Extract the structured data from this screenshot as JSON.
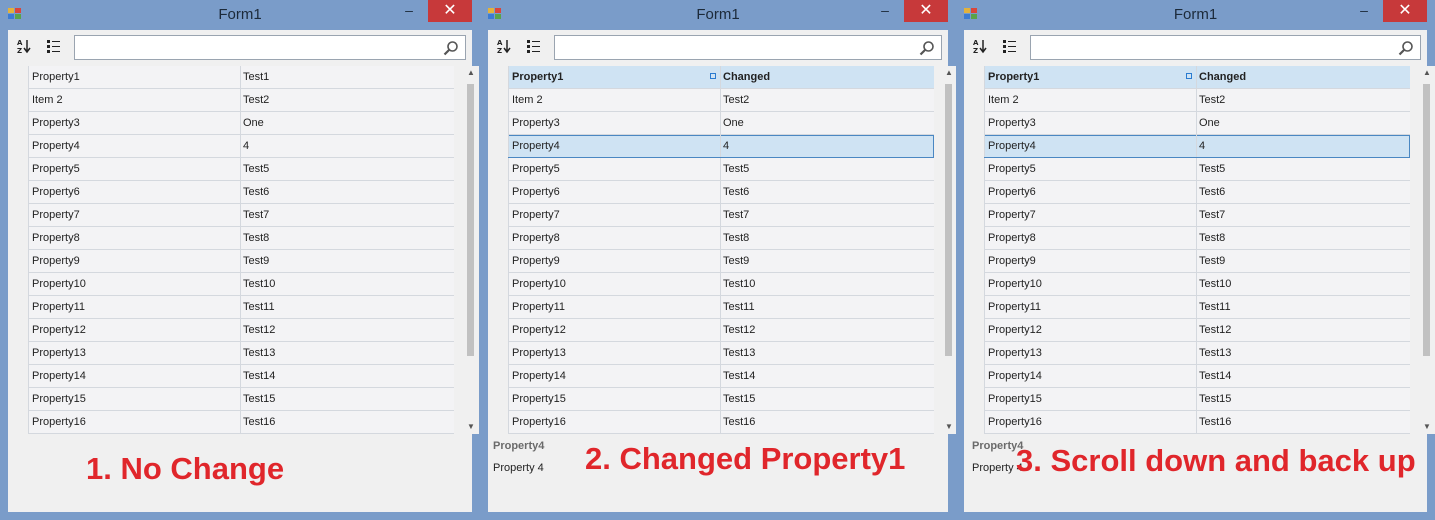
{
  "windows": [
    {
      "title": "Form1",
      "close_glyph": "✕",
      "min_glyph": "–",
      "search_placeholder": "",
      "caption": "1. No Change",
      "help_title": "",
      "help_desc": "",
      "rows": [
        {
          "name": "Property1",
          "value": "Test1"
        },
        {
          "name": "Item 2",
          "value": "Test2"
        },
        {
          "name": "Property3",
          "value": "One"
        },
        {
          "name": "Property4",
          "value": "4"
        },
        {
          "name": "Property5",
          "value": "Test5"
        },
        {
          "name": "Property6",
          "value": "Test6"
        },
        {
          "name": "Property7",
          "value": "Test7"
        },
        {
          "name": "Property8",
          "value": "Test8"
        },
        {
          "name": "Property9",
          "value": "Test9"
        },
        {
          "name": "Property10",
          "value": "Test10"
        },
        {
          "name": "Property11",
          "value": "Test11"
        },
        {
          "name": "Property12",
          "value": "Test12"
        },
        {
          "name": "Property13",
          "value": "Test13"
        },
        {
          "name": "Property14",
          "value": "Test14"
        },
        {
          "name": "Property15",
          "value": "Test15"
        },
        {
          "name": "Property16",
          "value": "Test16"
        }
      ]
    },
    {
      "title": "Form1",
      "close_glyph": "✕",
      "min_glyph": "–",
      "search_placeholder": "",
      "caption": "2. Changed Property1",
      "help_title": "Property4",
      "help_desc": "Property 4",
      "rows": [
        {
          "name": "Property1",
          "value": "Changed",
          "header": true
        },
        {
          "name": "Item 2",
          "value": "Test2"
        },
        {
          "name": "Property3",
          "value": "One"
        },
        {
          "name": "Property4",
          "value": "4",
          "selected": true
        },
        {
          "name": "Property5",
          "value": "Test5"
        },
        {
          "name": "Property6",
          "value": "Test6"
        },
        {
          "name": "Property7",
          "value": "Test7"
        },
        {
          "name": "Property8",
          "value": "Test8"
        },
        {
          "name": "Property9",
          "value": "Test9"
        },
        {
          "name": "Property10",
          "value": "Test10"
        },
        {
          "name": "Property11",
          "value": "Test11"
        },
        {
          "name": "Property12",
          "value": "Test12"
        },
        {
          "name": "Property13",
          "value": "Test13"
        },
        {
          "name": "Property14",
          "value": "Test14"
        },
        {
          "name": "Property15",
          "value": "Test15"
        },
        {
          "name": "Property16",
          "value": "Test16"
        }
      ]
    },
    {
      "title": "Form1",
      "close_glyph": "✕",
      "min_glyph": "–",
      "search_placeholder": "",
      "caption": "3. Scroll down and back up",
      "help_title": "Property4",
      "help_desc": "Property 4",
      "rows": [
        {
          "name": "Property1",
          "value": "Changed",
          "header": true
        },
        {
          "name": "Item 2",
          "value": "Test2"
        },
        {
          "name": "Property3",
          "value": "One"
        },
        {
          "name": "Property4",
          "value": "4",
          "selected": true
        },
        {
          "name": "Property5",
          "value": "Test5"
        },
        {
          "name": "Property6",
          "value": "Test6"
        },
        {
          "name": "Property7",
          "value": "Test7"
        },
        {
          "name": "Property8",
          "value": "Test8"
        },
        {
          "name": "Property9",
          "value": "Test9"
        },
        {
          "name": "Property10",
          "value": "Test10"
        },
        {
          "name": "Property11",
          "value": "Test11"
        },
        {
          "name": "Property12",
          "value": "Test12"
        },
        {
          "name": "Property13",
          "value": "Test13"
        },
        {
          "name": "Property14",
          "value": "Test14"
        },
        {
          "name": "Property15",
          "value": "Test15"
        },
        {
          "name": "Property16",
          "value": "Test16"
        }
      ]
    }
  ],
  "colors": {
    "window_frame": "#7a9cc9",
    "close_button": "#c7393a",
    "caption_text": "#e0262b",
    "selection": "#cfe3f3",
    "selection_border": "#4a87c2"
  },
  "icons": [
    "app-icon",
    "sort-alphabetical-icon",
    "sort-categorized-icon",
    "search-icon",
    "minimize-icon",
    "close-icon",
    "scroll-up-icon",
    "scroll-down-icon"
  ]
}
